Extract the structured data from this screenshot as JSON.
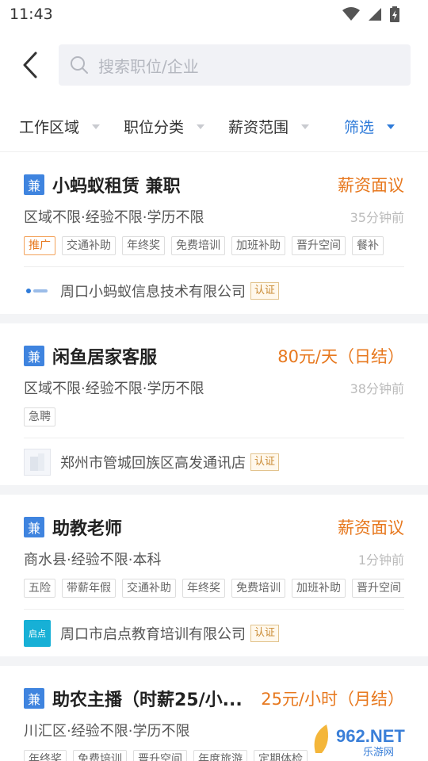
{
  "status_bar": {
    "time": "11:43"
  },
  "search": {
    "placeholder": "搜索职位/企业"
  },
  "filters": [
    {
      "label": "工作区域"
    },
    {
      "label": "职位分类"
    },
    {
      "label": "薪资范围"
    },
    {
      "label": "筛选"
    }
  ],
  "jobs": [
    {
      "badge": "兼",
      "title": "小蚂蚁租赁 兼职",
      "salary": "薪资面议",
      "meta": "区域不限·经验不限·学历不限",
      "time": "35分钟前",
      "tags": [
        "推广",
        "交通补助",
        "年终奖",
        "免费培训",
        "加班补助",
        "晋升空间",
        "餐补"
      ],
      "company": "周口小蚂蚁信息技术有限公司",
      "cert": "认证"
    },
    {
      "badge": "兼",
      "title": "闲鱼居家客服",
      "salary": "80元/天（日结）",
      "meta": "区域不限·经验不限·学历不限",
      "time": "38分钟前",
      "tags": [
        "急聘"
      ],
      "company": "郑州市管城回族区高发通讯店",
      "cert": "认证"
    },
    {
      "badge": "兼",
      "title": "助教老师",
      "salary": "薪资面议",
      "meta": "商水县·经验不限·本科",
      "time": "1分钟前",
      "tags": [
        "五险",
        "带薪年假",
        "交通补助",
        "年终奖",
        "免费培训",
        "加班补助",
        "晋升空间"
      ],
      "company": "周口市启点教育培训有限公司",
      "cert": "认证",
      "logo_text": "启点"
    },
    {
      "badge": "兼",
      "title": "助农主播（时薪25/小...",
      "salary": "25元/小时（月结）",
      "meta": "川汇区·经验不限·学历不限",
      "time": "",
      "tags": [
        "年终奖",
        "免费培训",
        "晋升空间",
        "年度旅游",
        "定期体检"
      ]
    }
  ],
  "watermark": {
    "text": "962.NET",
    "sub": "乐游网"
  },
  "colors": {
    "accent": "#2f7bd9",
    "salary": "#e7781e",
    "badge": "#3f84df"
  }
}
